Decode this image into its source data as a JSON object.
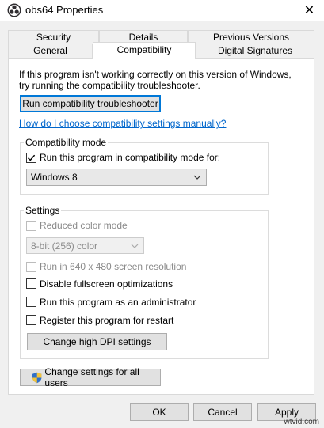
{
  "window": {
    "title": "obs64 Properties",
    "close_glyph": "✕"
  },
  "tabs": {
    "row1": [
      {
        "label": "Security"
      },
      {
        "label": "Details"
      },
      {
        "label": "Previous Versions"
      }
    ],
    "row2": [
      {
        "label": "General"
      },
      {
        "label": "Compatibility"
      },
      {
        "label": "Digital Signatures"
      }
    ]
  },
  "intro": {
    "line1": "If this program isn't working correctly on this version of Windows,",
    "line2": "try running the compatibility troubleshooter."
  },
  "troubleshooter_button": "Run compatibility troubleshooter",
  "manual_link": "How do I choose compatibility settings manually?",
  "compat_mode": {
    "label": "Compatibility mode",
    "checkbox_label": "Run this program in compatibility mode for:",
    "checked": true,
    "selected_os": "Windows 8"
  },
  "settings": {
    "label": "Settings",
    "reduced_color_label": "Reduced color mode",
    "color_select_value": "8-bit (256) color",
    "run_640_label": "Run in 640 x 480 screen resolution",
    "disable_fullscreen_label": "Disable fullscreen optimizations",
    "run_admin_label": "Run this program as an administrator",
    "register_restart_label": "Register this program for restart",
    "dpi_button": "Change high DPI settings"
  },
  "all_users_button": "Change settings for all users",
  "footer": {
    "ok": "OK",
    "cancel": "Cancel",
    "apply": "Apply"
  },
  "watermark": "wtvid.com",
  "colors": {
    "link": "#0066cc",
    "accent": "#0078d7",
    "dialog_bg": "#f0f0f0"
  }
}
